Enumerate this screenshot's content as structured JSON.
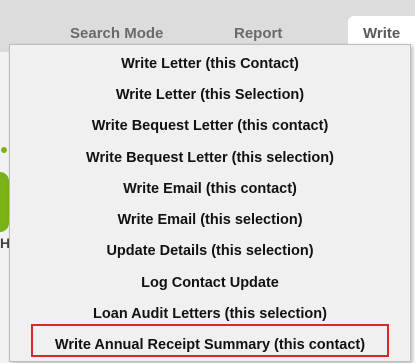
{
  "tabs": {
    "search_mode": "Search Mode",
    "report": "Report",
    "write": "Write"
  },
  "left_fragment": "H",
  "menu": {
    "items": [
      "Write Letter (this Contact)",
      "Write Letter (this Selection)",
      "Write Bequest Letter (this contact)",
      "Write Bequest Letter (this selection)",
      "Write Email (this contact)",
      "Write Email (this selection)",
      "Update Details (this selection)",
      "Log Contact Update",
      "Loan Audit Letters (this selection)",
      "Write Annual Receipt Summary (this contact)"
    ],
    "highlighted_item": "Write Annual Receipt Summary (this contact)",
    "highlight_color": "#e0242a"
  }
}
